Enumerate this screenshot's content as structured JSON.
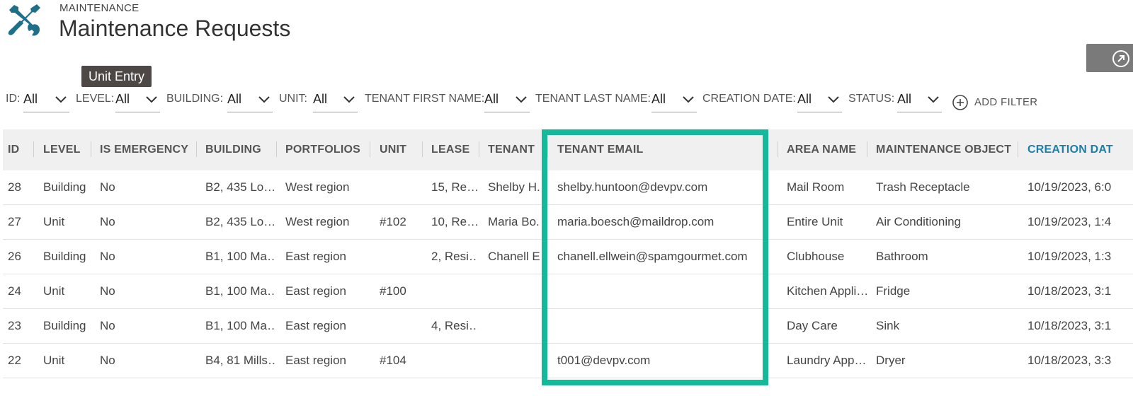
{
  "header": {
    "eyebrow": "MAINTENANCE",
    "title": "Maintenance Requests",
    "icon": "wrench-screwdriver-icon",
    "icon_color": "#1e6f8a"
  },
  "tooltip": "Unit Entry",
  "filters": [
    {
      "label": "ID:",
      "value": "All"
    },
    {
      "label": "LEVEL:",
      "value": "All"
    },
    {
      "label": "BUILDING:",
      "value": "All"
    },
    {
      "label": "UNIT:",
      "value": "All"
    },
    {
      "label": "TENANT FIRST NAME:",
      "value": "All"
    },
    {
      "label": "TENANT LAST NAME:",
      "value": "All"
    },
    {
      "label": "CREATION DATE:",
      "value": "All"
    },
    {
      "label": "STATUS:",
      "value": "All"
    }
  ],
  "add_filter_label": "ADD FILTER",
  "columns": [
    "ID",
    "LEVEL",
    "IS EMERGENCY",
    "BUILDING",
    "PORTFOLIOS",
    "UNIT",
    "LEASE",
    "TENANT",
    "TENANT EMAIL",
    "AREA NAME",
    "MAINTENANCE OBJECT",
    "CREATION DAT"
  ],
  "rows": [
    [
      "28",
      "Building",
      "No",
      "B2, 435 Lo…",
      "West region",
      "",
      "15, Re…",
      "Shelby H.",
      "shelby.huntoon@devpv.com",
      "Mail Room",
      "Trash Receptacle",
      "10/19/2023, 6:0"
    ],
    [
      "27",
      "Unit",
      "No",
      "B2, 435 Lo…",
      "West region",
      "#102",
      "10, Re…",
      "Maria Bo.",
      "maria.boesch@maildrop.com",
      "Entire Unit",
      "Air Conditioning",
      "10/19/2023, 1:4"
    ],
    [
      "26",
      "Building",
      "No",
      "B1, 100 Ma…",
      "East region",
      "",
      "2, Resi…",
      "Chanell E",
      "chanell.ellwein@spamgourmet.com",
      "Clubhouse",
      "Bathroom",
      "10/19/2023, 1:3"
    ],
    [
      "24",
      "Unit",
      "No",
      "B1, 100 Ma…",
      "East region",
      "#100",
      "",
      "",
      "",
      "Kitchen Appli…",
      "Fridge",
      "10/18/2023, 3:1"
    ],
    [
      "23",
      "Building",
      "No",
      "B1, 100 Ma…",
      "East region",
      "",
      "4, Resi…",
      "",
      "",
      "Day Care",
      "Sink",
      "10/18/2023, 3:1"
    ],
    [
      "22",
      "Unit",
      "No",
      "B4, 81 Mills…",
      "East region",
      "#104",
      "",
      "",
      "t001@devpv.com",
      "Laundry App…",
      "Dryer",
      "10/18/2023, 3:3"
    ]
  ],
  "colors": {
    "highlight": "#14b89a",
    "sorted_header": "#1d7fa6",
    "tooltip_bg": "#4d4846",
    "corner_button": "#7a7a7a"
  },
  "corner_button_icon": "open-external-icon"
}
